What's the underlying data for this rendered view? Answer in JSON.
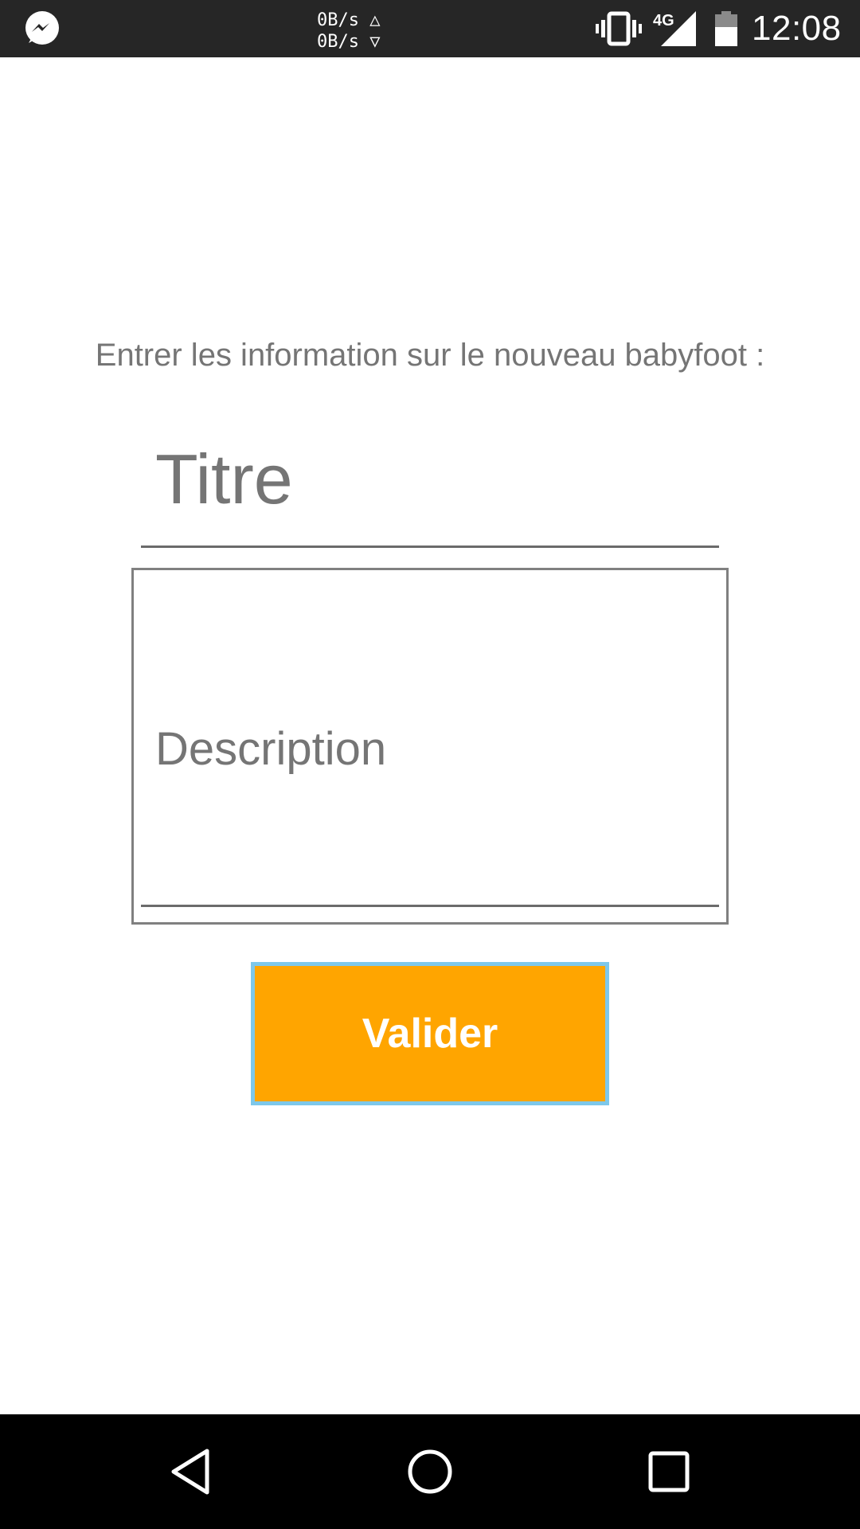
{
  "status_bar": {
    "net_up": "0B/s △",
    "net_down": "0B/s ▽",
    "network_type": "4G",
    "time": "12:08",
    "icons": [
      "messenger-icon",
      "vibrate-icon",
      "signal-4g-icon",
      "battery-icon"
    ],
    "background_color": "#262626"
  },
  "form": {
    "instruction": "Entrer les information sur le nouveau babyfoot :",
    "title_placeholder": "Titre",
    "description_placeholder": "Description",
    "submit_label": "Valider",
    "submit_color": "#ffa500",
    "submit_border_color": "#7ec8ea"
  },
  "nav_bar": {
    "icons": [
      "back-icon",
      "home-icon",
      "recent-apps-icon"
    ]
  }
}
